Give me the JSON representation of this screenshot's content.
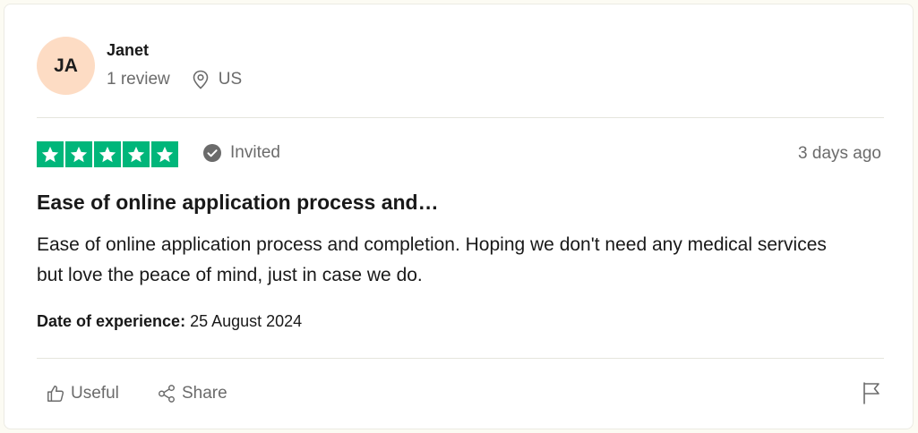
{
  "reviewer": {
    "initials": "JA",
    "name": "Janet",
    "review_count": "1 review",
    "country": "US"
  },
  "review": {
    "rating": 5,
    "invited_label": "Invited",
    "posted": "3 days ago",
    "title": "Ease of online application process and…",
    "body": "Ease of online application process and completion. Hoping we don't need any medical services but love the peace of mind, just in case we do.",
    "experience_label": "Date of experience:",
    "experience_date": "25 August 2024"
  },
  "actions": {
    "useful_label": "Useful",
    "share_label": "Share"
  },
  "colors": {
    "star_green": "#00b67a",
    "avatar_bg": "#fddcc4",
    "muted_text": "#6b6b6b"
  },
  "icons": [
    "location-pin-icon",
    "check-circle-icon",
    "star-icon",
    "thumbs-up-icon",
    "share-icon",
    "flag-icon"
  ]
}
